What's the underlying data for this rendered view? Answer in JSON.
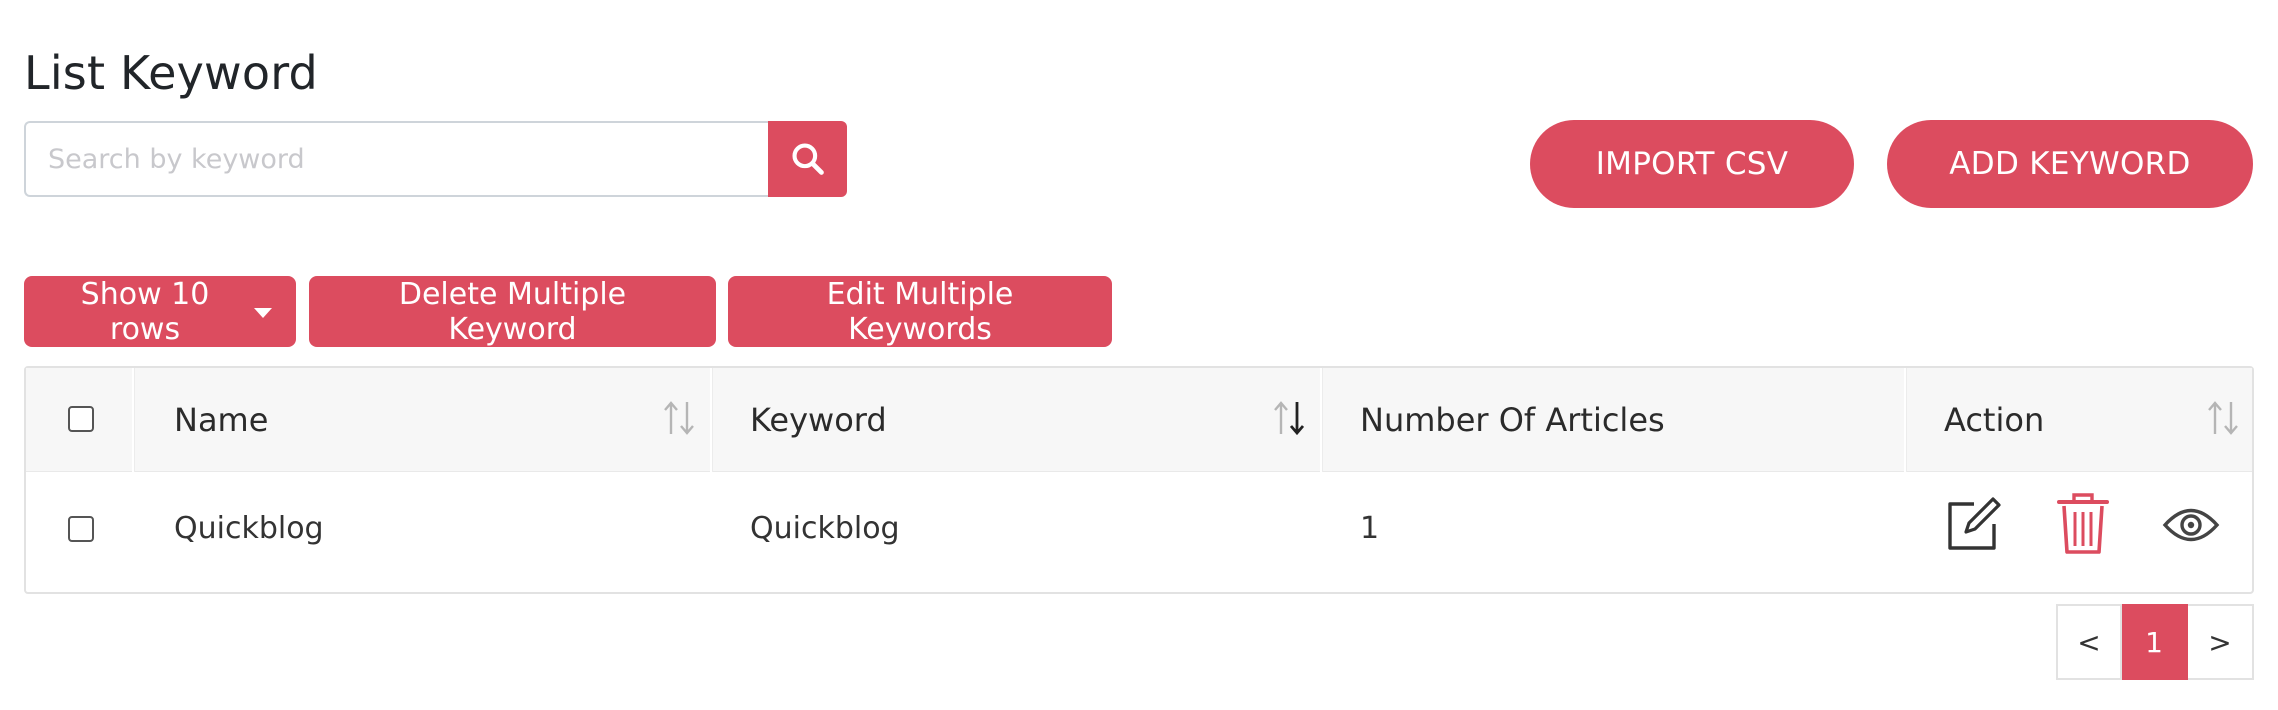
{
  "page": {
    "title": "List Keyword"
  },
  "search": {
    "placeholder": "Search by keyword",
    "value": ""
  },
  "actions": {
    "import_label": "IMPORT CSV",
    "add_label": "ADD KEYWORD"
  },
  "toolbar": {
    "rows_label": "Show 10 rows",
    "delete_multiple_label": "Delete Multiple Keyword",
    "edit_multiple_label": "Edit Multiple Keywords"
  },
  "table": {
    "columns": [
      "Name",
      "Keyword",
      "Number Of Articles",
      "Action"
    ],
    "rows": [
      {
        "name": "Quickblog",
        "keyword": "Quickblog",
        "articles": "1"
      }
    ]
  },
  "pagination": {
    "prev": "<",
    "current": "1",
    "next": ">"
  },
  "colors": {
    "accent": "#dc4c5f",
    "header_bg": "#f7f7f7",
    "border": "#e2e2e2"
  },
  "icons": [
    "search-icon",
    "sort-icon",
    "edit-icon",
    "trash-icon",
    "eye-icon"
  ]
}
